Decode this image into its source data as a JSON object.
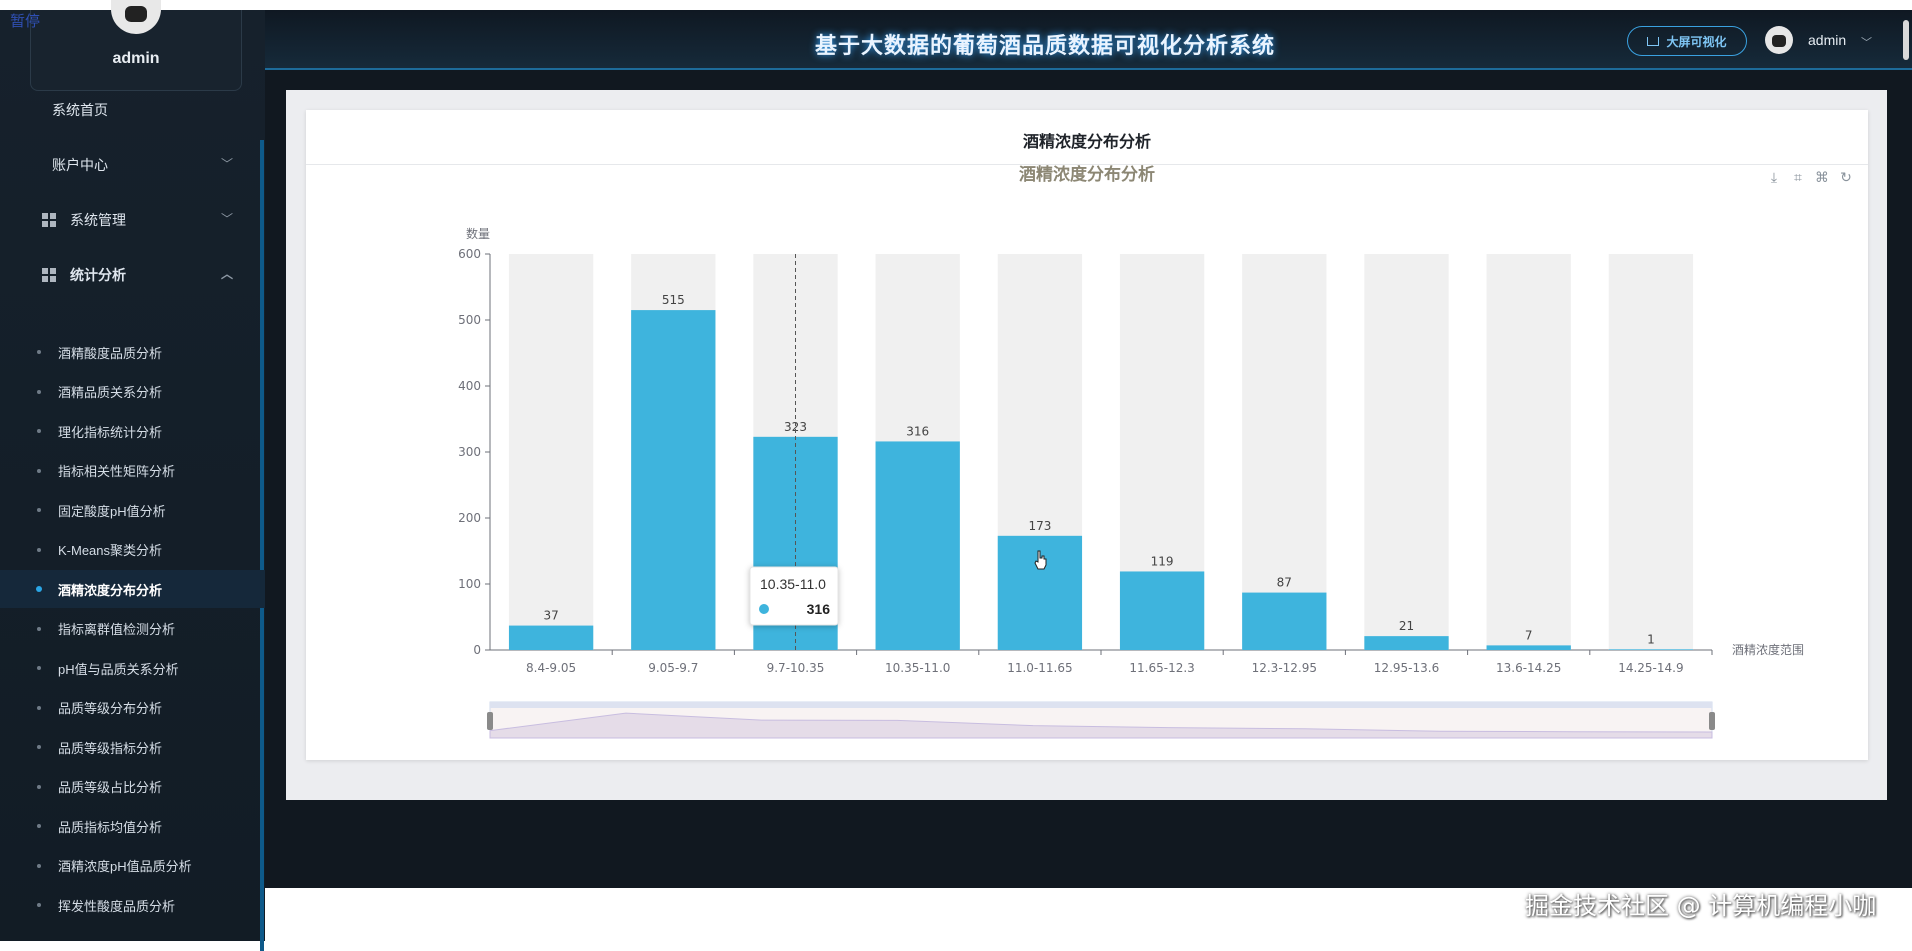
{
  "overlay": {
    "pause_label": "暂停"
  },
  "sidebar": {
    "username": "admin",
    "top_items": [
      {
        "label": "系统首页",
        "has_icon": false,
        "chevron": ""
      },
      {
        "label": "账户中心",
        "has_icon": false,
        "chevron": "﹀"
      },
      {
        "label": "系统管理",
        "has_icon": true,
        "chevron": "﹀"
      },
      {
        "label": "统计分析",
        "has_icon": true,
        "chevron": "︿"
      }
    ],
    "sub_items": [
      "酒精酸度品质分析",
      "酒精品质关系分析",
      "理化指标统计分析",
      "指标相关性矩阵分析",
      "固定酸度pH值分析",
      "K-Means聚类分析",
      "酒精浓度分布分析",
      "指标离群值检测分析",
      "pH值与品质关系分析",
      "品质等级分布分析",
      "品质等级指标分析",
      "品质等级占比分析",
      "品质指标均值分析",
      "酒精浓度pH值品质分析",
      "挥发性酸度品质分析"
    ],
    "active_index": 6
  },
  "header": {
    "title": "基于大数据的葡萄酒品质数据可视化分析系统",
    "bigscreen_label": "大屏可视化",
    "username": "admin",
    "chevron": "﹀"
  },
  "card": {
    "title": "酒精浓度分布分析"
  },
  "toolbar_icons": [
    "download-icon",
    "zoom-icon",
    "zoom-reset-icon",
    "restore-icon"
  ],
  "chart_data": {
    "type": "bar",
    "title": "酒精浓度分布分析",
    "xlabel": "酒精浓度范围",
    "ylabel": "数量",
    "ylim": [
      0,
      600
    ],
    "yticks": [
      0,
      100,
      200,
      300,
      400,
      500,
      600
    ],
    "categories": [
      "8.4-9.05",
      "9.05-9.7",
      "9.7-10.35",
      "10.35-11.0",
      "11.0-11.65",
      "11.65-12.3",
      "12.3-12.95",
      "12.95-13.6",
      "13.6-14.25",
      "14.25-14.9"
    ],
    "values": [
      37,
      515,
      323,
      316,
      173,
      119,
      87,
      21,
      7,
      1
    ],
    "background_bars": true,
    "bar_color": "#3eb4dd",
    "background_color": "#f0f0f0",
    "title_color": "#8c8774",
    "tooltip": {
      "category": "10.35-11.0",
      "value": 316
    },
    "data_zoom": true
  },
  "watermark": "掘金技术社区 @ 计算机编程小咖"
}
